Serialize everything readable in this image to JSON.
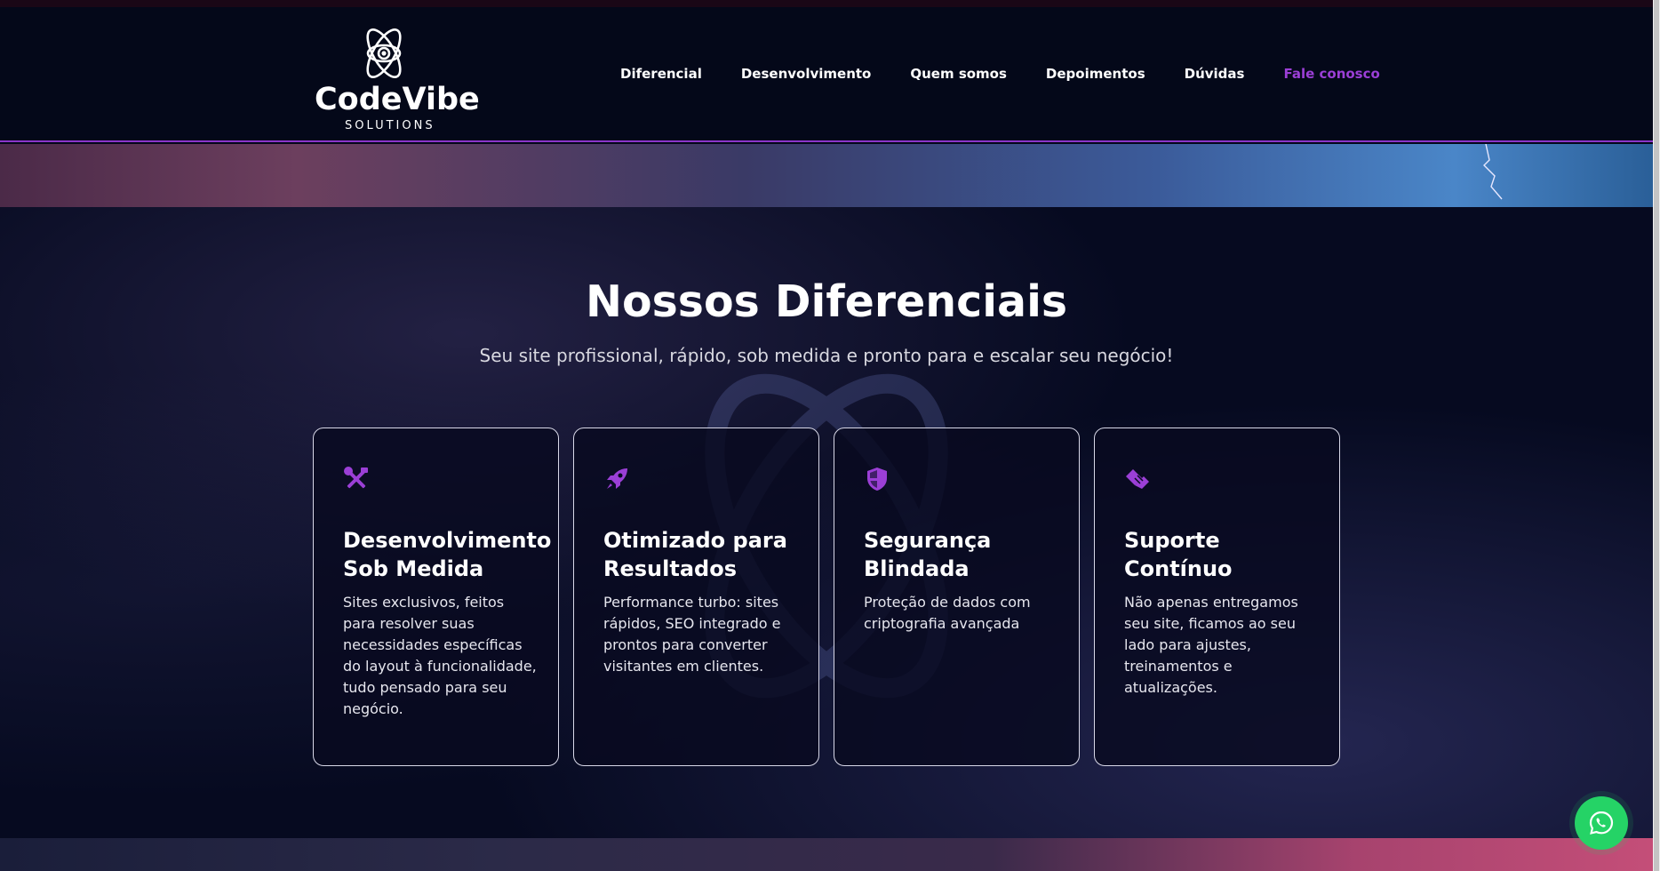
{
  "brand": {
    "name": "CodeVibe",
    "tagline": "SOLUTIONS",
    "logo_icon": "atom-icon"
  },
  "nav": {
    "items": [
      {
        "label": "Diferencial"
      },
      {
        "label": "Desenvolvimento"
      },
      {
        "label": "Quem somos"
      },
      {
        "label": "Depoimentos"
      },
      {
        "label": "Dúvidas"
      },
      {
        "label": "Fale conosco",
        "accent": true
      }
    ]
  },
  "section": {
    "title": "Nossos Diferenciais",
    "subtitle": "Seu site profissional, rápido, sob medida e pronto para e escalar seu negócio!"
  },
  "cards": [
    {
      "icon": "tools-icon",
      "title": "Desenvolvimento Sob Medida",
      "text": "Sites exclusivos, feitos para resolver suas necessidades específicas do layout à funcionalidade, tudo pensado para seu negócio."
    },
    {
      "icon": "rocket-icon",
      "title": "Otimizado para Resultados",
      "text": "Performance turbo: sites rápidos, SEO integrado e prontos para converter visitantes em clientes."
    },
    {
      "icon": "shield-icon",
      "title": "Segurança Blindada",
      "text": "Proteção de dados com criptografia avançada"
    },
    {
      "icon": "handshake-icon",
      "title": "Suporte Contínuo",
      "text": "Não apenas entregamos seu site, ficamos ao seu lado para ajustes, treinamentos e atualizações."
    }
  ],
  "floating": {
    "whatsapp_icon": "whatsapp-icon"
  },
  "colors": {
    "accent": "#9b3fd6",
    "background": "#060a20",
    "whatsapp": "#25d366"
  }
}
